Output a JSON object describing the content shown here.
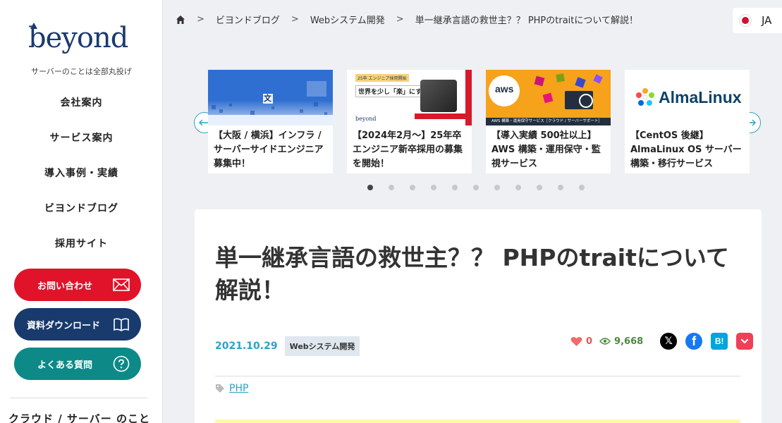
{
  "sidebar": {
    "logo": "beyond",
    "tagline": "サーバーのことは全部丸投げ",
    "nav": [
      {
        "label": "会社案内"
      },
      {
        "label": "サービス案内"
      },
      {
        "label": "導入事例・実績"
      },
      {
        "label": "ビヨンドブログ"
      },
      {
        "label": "採用サイト"
      }
    ],
    "cta_contact": "お問い合わせ",
    "cta_download": "資料ダウンロード",
    "cta_faq": "よくある質問",
    "bottom_text": "クラウド / サーバー のこと"
  },
  "breadcrumb": {
    "items": [
      "ビヨンドブログ",
      "Webシステム開発",
      "単一継承言語の救世主？？ PHPのtraitについて解説！"
    ],
    "separator": ">"
  },
  "language": "JA",
  "carousel": {
    "slides": [
      {
        "title": "【大阪 / 横浜】インフラ / サーバーサイドエンジニア募集中！",
        "image_text": "文"
      },
      {
        "title": "【2024年2月〜】25年卒エンジニア新卒採用の募集を開始！",
        "image_text": "世界を少し「楽」にする",
        "image_badge": "25卒 エンジニア採用開始",
        "image_brand": "beyond"
      },
      {
        "title": "【導入実績 500社以上】AWS 構築・運用保守・監視サービス",
        "image_text": "aws",
        "image_caption": "AWS 構築・運用保守サービス［クラウド / サーバーサポート］"
      },
      {
        "title": "【CentOS 後継】AlmaLinux OS サーバー構築・移行サービス",
        "image_text": "AlmaLinux"
      }
    ],
    "dot_count": 11,
    "active_dot": 0
  },
  "article": {
    "title": "単一継承言語の救世主？？ PHPのtraitについて解説！",
    "date": "2021.10.29",
    "category": "Webシステム開発",
    "likes": "0",
    "views": "9,668",
    "share_x": "𝕏",
    "share_fb": "f",
    "share_hb": "B!",
    "tag": "PHP"
  },
  "colors": {
    "brand_navy": "#1b3a6e",
    "red": "#e0132a",
    "teal": "#0d8a87",
    "accent": "#2aa3c6"
  }
}
